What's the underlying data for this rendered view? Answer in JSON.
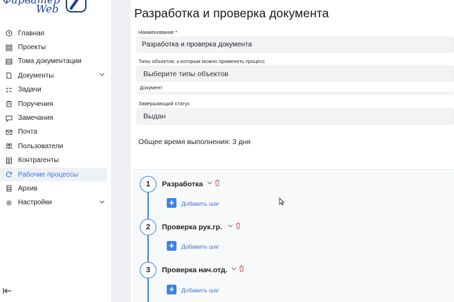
{
  "app": {
    "logo_line1": "Фарватер",
    "logo_line2": "Web"
  },
  "sidebar": {
    "items": [
      {
        "label": "Главная",
        "icon": "clock-icon"
      },
      {
        "label": "Проекты",
        "icon": "grid-icon"
      },
      {
        "label": "Тома документации",
        "icon": "stack-icon"
      },
      {
        "label": "Документы",
        "icon": "file-icon",
        "expandable": true
      },
      {
        "label": "Задачи",
        "icon": "checklist-icon"
      },
      {
        "label": "Поручения",
        "icon": "clipboard-icon"
      },
      {
        "label": "Замечания",
        "icon": "comment-icon"
      },
      {
        "label": "Почта",
        "icon": "mail-icon"
      },
      {
        "label": "Пользователи",
        "icon": "users-icon"
      },
      {
        "label": "Контрагенты",
        "icon": "contacts-icon"
      },
      {
        "label": "Рабочие процессы",
        "icon": "refresh-icon",
        "active": true
      },
      {
        "label": "Архив",
        "icon": "archive-icon"
      },
      {
        "label": "Настройки",
        "icon": "gear-icon",
        "expandable": true
      }
    ],
    "collapse_icon": "collapse-left-icon"
  },
  "page": {
    "title": "Разработка и проверка документа"
  },
  "form": {
    "name_label": "Наименование *",
    "name_value": "Разработка и проверка документа",
    "object_types_label": "Типы объектов, к которым можно применять процесс",
    "object_types_placeholder": "Выберите типы объектов",
    "document_label": "Документ",
    "final_status_label": "Завершающий статус",
    "final_status_value": "Выдан"
  },
  "total_time": "Общее время выполнения: 3 дня",
  "steps": [
    {
      "number": "1",
      "name": "Разработка",
      "add_label": "Добавить шаг"
    },
    {
      "number": "2",
      "name": "Проверка рук.гр.",
      "add_label": "Добавить шаг"
    },
    {
      "number": "3",
      "name": "Проверка нач.отд.",
      "add_label": "Добавить шаг"
    }
  ],
  "colors": {
    "accent": "#3b82e6",
    "active_nav_text": "#3b78e7",
    "delete": "#e05a5a",
    "logo": "#1b3f8f"
  }
}
